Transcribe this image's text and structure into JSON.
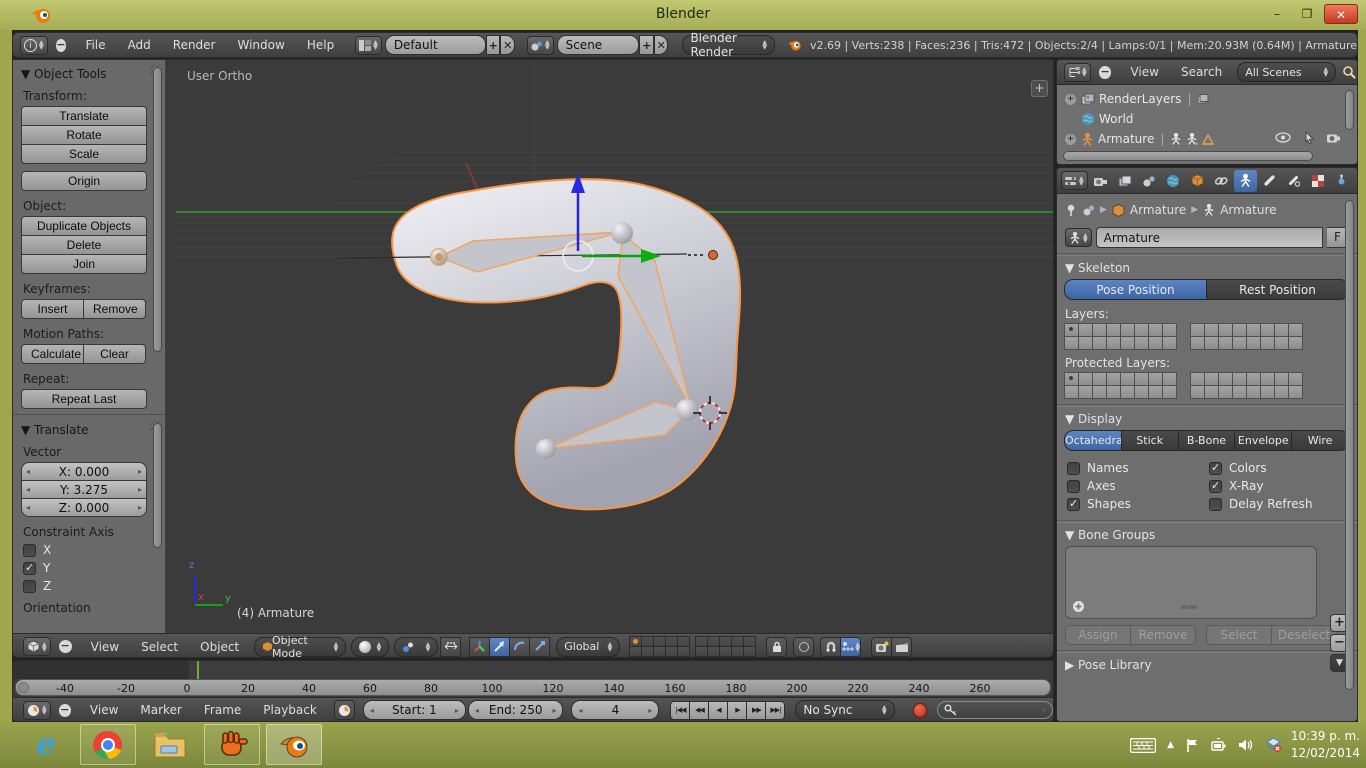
{
  "window": {
    "title": "Blender",
    "minimize": "–",
    "maximize": "❐",
    "close": "✕"
  },
  "info_header": {
    "menus": [
      "File",
      "Add",
      "Render",
      "Window",
      "Help"
    ],
    "layout_value": "Default",
    "scene_value": "Scene",
    "engine_value": "Blender Render",
    "stats": "v2.69 | Verts:238 | Faces:236 | Tris:472 | Objects:2/4 | Lamps:0/1 | Mem:20.93M (0.64M) | Armature"
  },
  "tool_shelf": {
    "panel_title": "▼ Object Tools",
    "transform_label": "Transform:",
    "translate": "Translate",
    "rotate": "Rotate",
    "scale": "Scale",
    "origin": "Origin",
    "object_label": "Object:",
    "duplicate": "Duplicate Objects",
    "delete": "Delete",
    "join": "Join",
    "keyframes_label": "Keyframes:",
    "insert": "Insert",
    "remove": "Remove",
    "motion_label": "Motion Paths:",
    "calculate": "Calculate",
    "clear": "Clear",
    "repeat_label": "Repeat:",
    "repeat_last": "Repeat Last"
  },
  "redo_panel": {
    "panel_title": "▼ Translate",
    "vector_label": "Vector",
    "x_value": "X: 0.000",
    "y_value": "Y: 3.275",
    "z_value": "Z: 0.000",
    "constraint_label": "Constraint Axis",
    "axis_x": "X",
    "axis_y": "Y",
    "axis_z": "Z",
    "axis_x_checked": false,
    "axis_y_checked": true,
    "axis_z_checked": false,
    "orientation_label": "Orientation"
  },
  "viewport": {
    "view_label": "User Ortho",
    "object_label": "(4) Armature",
    "axis_x": "x",
    "axis_y": "y",
    "axis_z": "z",
    "add_panel_tab": "+"
  },
  "view3d_header": {
    "menus": [
      "View",
      "Select",
      "Object"
    ],
    "mode_value": "Object Mode",
    "orientation_value": "Global"
  },
  "outliner": {
    "menus": [
      "View",
      "Search"
    ],
    "filter_value": "All Scenes",
    "row_renderlayers": "RenderLayers",
    "row_world": "World",
    "row_armature": "Armature"
  },
  "properties": {
    "tabs": [
      "render",
      "render-layers",
      "scene",
      "world",
      "object",
      "constraints",
      "object-data",
      "bone",
      "bone-constraints",
      "texture",
      "physics"
    ],
    "breadcrumb_object": "Armature",
    "breadcrumb_data": "Armature",
    "name_value": "Armature",
    "fake_user": "F",
    "skeleton": {
      "title": "▼ Skeleton",
      "pose_position": "Pose Position",
      "rest_position": "Rest Position",
      "layers_label": "Layers:",
      "protected_label": "Protected Layers:"
    },
    "display": {
      "title": "▼ Display",
      "modes": [
        "Octahedral",
        "Stick",
        "B-Bone",
        "Envelope",
        "Wire"
      ],
      "active_mode": "Octahedral",
      "names": "Names",
      "colors": "Colors",
      "axes": "Axes",
      "xray": "X-Ray",
      "shapes": "Shapes",
      "delay": "Delay Refresh",
      "names_checked": false,
      "colors_checked": true,
      "axes_checked": false,
      "xray_checked": true,
      "shapes_checked": true,
      "delay_checked": false
    },
    "bone_groups": {
      "title": "▼ Bone Groups",
      "assign": "Assign",
      "remove": "Remove",
      "select": "Select",
      "deselect": "Deselect"
    },
    "pose_library_title": "▶ Pose Library"
  },
  "timeline": {
    "menus": [
      "View",
      "Marker",
      "Frame",
      "Playback"
    ],
    "start_value": "Start: 1",
    "end_value": "End: 250",
    "frame_value": "4",
    "playback_buttons": [
      "|◀◀",
      "◀◀",
      "◀",
      "▶",
      "▶▶",
      "▶▶|"
    ],
    "sync_value": "No Sync",
    "ruler": [
      "-40",
      "-20",
      "0",
      "20",
      "40",
      "60",
      "80",
      "100",
      "120",
      "140",
      "160",
      "180",
      "200",
      "220",
      "240",
      "260"
    ]
  },
  "taskbar": {
    "time": "10:39 p. m.",
    "date": "12/02/2014"
  },
  "colors": {
    "accent_blue": "#4a72b0",
    "selection_orange": "#f79640",
    "frame_green": "#69b32c"
  }
}
